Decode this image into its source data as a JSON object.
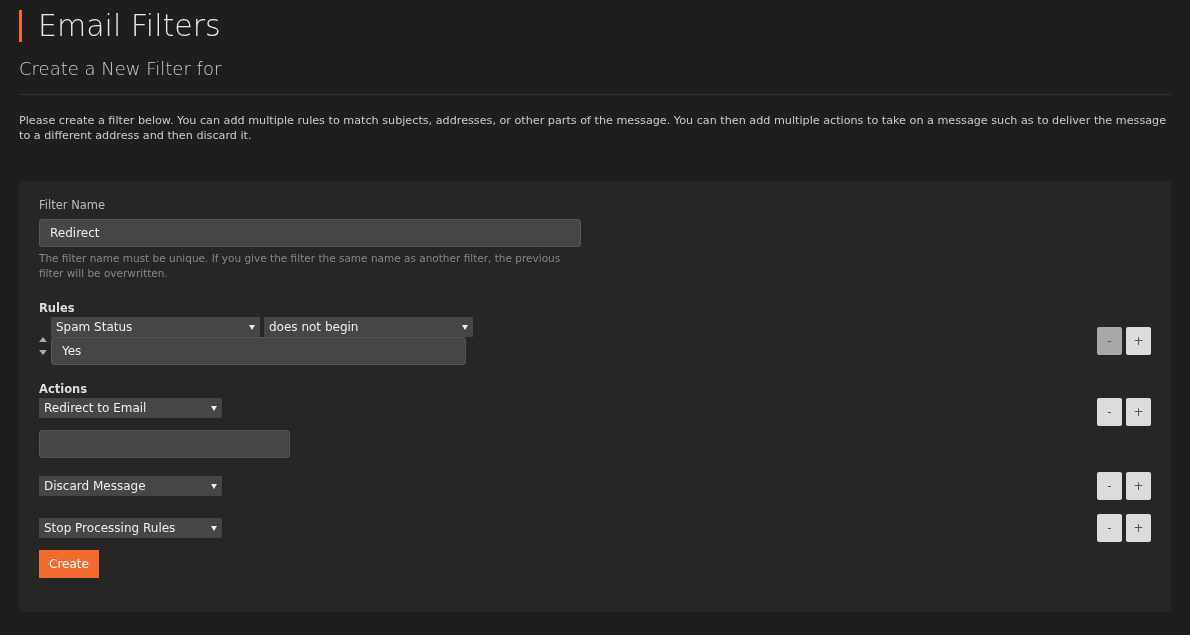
{
  "title": "Email Filters",
  "subtitle": "Create a New Filter for",
  "intro": "Please create a filter below. You can add multiple rules to match subjects, addresses, or other parts of the message. You can then add multiple actions to take on a message such as to deliver the message to a different address and then discard it.",
  "filter_name": {
    "label": "Filter Name",
    "value": "Redirect",
    "help": "The filter name must be unique. If you give the filter the same name as another filter, the previous filter will be overwritten."
  },
  "rules": {
    "label": "Rules",
    "items": [
      {
        "part": "Spam Status",
        "match": "does not begin",
        "value": "Yes",
        "remove": {
          "label": "-",
          "disabled": true
        },
        "add": {
          "label": "+",
          "disabled": false
        }
      }
    ]
  },
  "actions": {
    "label": "Actions",
    "items": [
      {
        "kind": "input",
        "action": "Redirect to Email",
        "remove": {
          "label": "-",
          "disabled": false
        },
        "add": {
          "label": "+",
          "disabled": false
        }
      },
      {
        "kind": "plain",
        "action": "Discard Message",
        "remove": {
          "label": "-",
          "disabled": false
        },
        "add": {
          "label": "+",
          "disabled": false
        }
      },
      {
        "kind": "plain",
        "action": "Stop Processing Rules",
        "remove": {
          "label": "-",
          "disabled": false
        },
        "add": {
          "label": "+",
          "disabled": false
        }
      }
    ]
  },
  "submit": "Create"
}
